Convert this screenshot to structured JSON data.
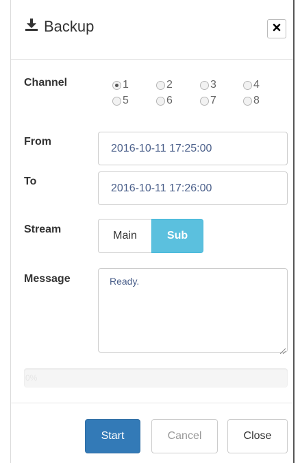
{
  "dialog": {
    "title": "Backup",
    "title_icon": "download-icon",
    "close_icon": "close-icon"
  },
  "channel": {
    "label": "Channel",
    "options": [
      "1",
      "2",
      "3",
      "4",
      "5",
      "6",
      "7",
      "8"
    ],
    "selected": "1"
  },
  "from": {
    "label": "From",
    "value": "2016-10-11 17:25:00"
  },
  "to": {
    "label": "To",
    "value": "2016-10-11 17:26:00"
  },
  "stream": {
    "label": "Stream",
    "options": [
      "Main",
      "Sub"
    ],
    "selected": "Sub"
  },
  "message": {
    "label": "Message",
    "value": "Ready."
  },
  "progress": {
    "text": "0%",
    "value": 0
  },
  "footer": {
    "start_label": "Start",
    "cancel_label": "Cancel",
    "close_label": "Close"
  },
  "colors": {
    "primary": "#337ab7",
    "info": "#5bc0de",
    "border": "#cccccc"
  }
}
